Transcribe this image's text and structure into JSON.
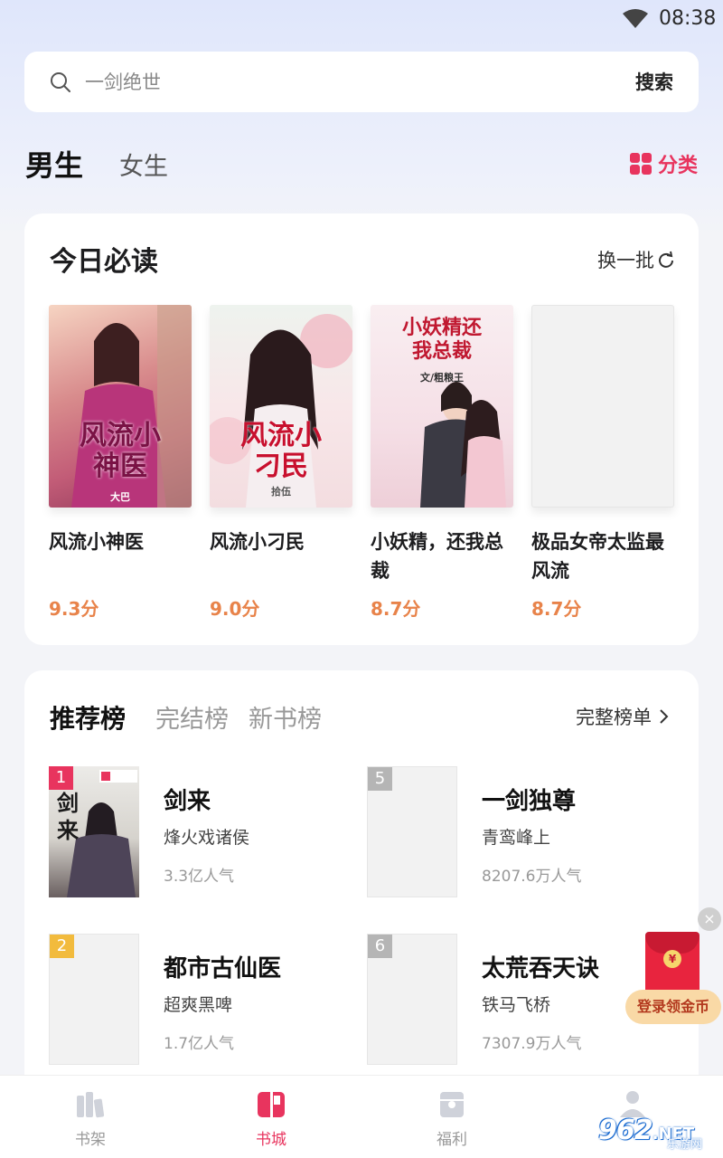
{
  "status": {
    "time": "08:38"
  },
  "search": {
    "placeholder": "一剑绝世",
    "button": "搜索"
  },
  "gender_tabs": {
    "male": "男生",
    "female": "女生"
  },
  "category": {
    "label": "分类"
  },
  "today": {
    "title": "今日必读",
    "refresh": "换一批",
    "books": [
      {
        "name": "风流小神医",
        "score": "9.3分",
        "cover_text": "风流小神医",
        "cover_author": "大巴"
      },
      {
        "name": "风流小刁民",
        "score": "9.0分",
        "cover_text": "风流小刁民",
        "cover_author": "拾伍"
      },
      {
        "name": "小妖精，还我总裁",
        "score": "8.7分",
        "cover_text": "小妖精还我总裁",
        "cover_author": "文/粗粮王"
      },
      {
        "name": "极品女帝太监最风流",
        "score": "8.7分"
      }
    ]
  },
  "ranking": {
    "tabs": [
      "推荐榜",
      "完结榜",
      "新书榜"
    ],
    "full_list": "完整榜单",
    "items": [
      {
        "rank": "1",
        "title": "剑来",
        "author": "烽火戏诸侯",
        "popularity": "3.3亿人气",
        "cover_text": "剑来"
      },
      {
        "rank": "5",
        "title": "一剑独尊",
        "author": "青鸾峰上",
        "popularity": "8207.6万人气"
      },
      {
        "rank": "2",
        "title": "都市古仙医",
        "author": "超爽黑啤",
        "popularity": "1.7亿人气"
      },
      {
        "rank": "6",
        "title": "太荒吞天诀",
        "author": "铁马飞桥",
        "popularity": "7307.9万人气"
      }
    ]
  },
  "promo": {
    "label": "登录领金币",
    "close": "×",
    "coin": "¥"
  },
  "nav": {
    "shelf": "书架",
    "store": "书城",
    "welfare": "福利"
  },
  "watermark": {
    "num": "962",
    "net": ".NET",
    "sub": "乐游网"
  },
  "colors": {
    "accent": "#e8345e",
    "score": "#e8834a",
    "badge_yellow": "#f2bb3d"
  }
}
